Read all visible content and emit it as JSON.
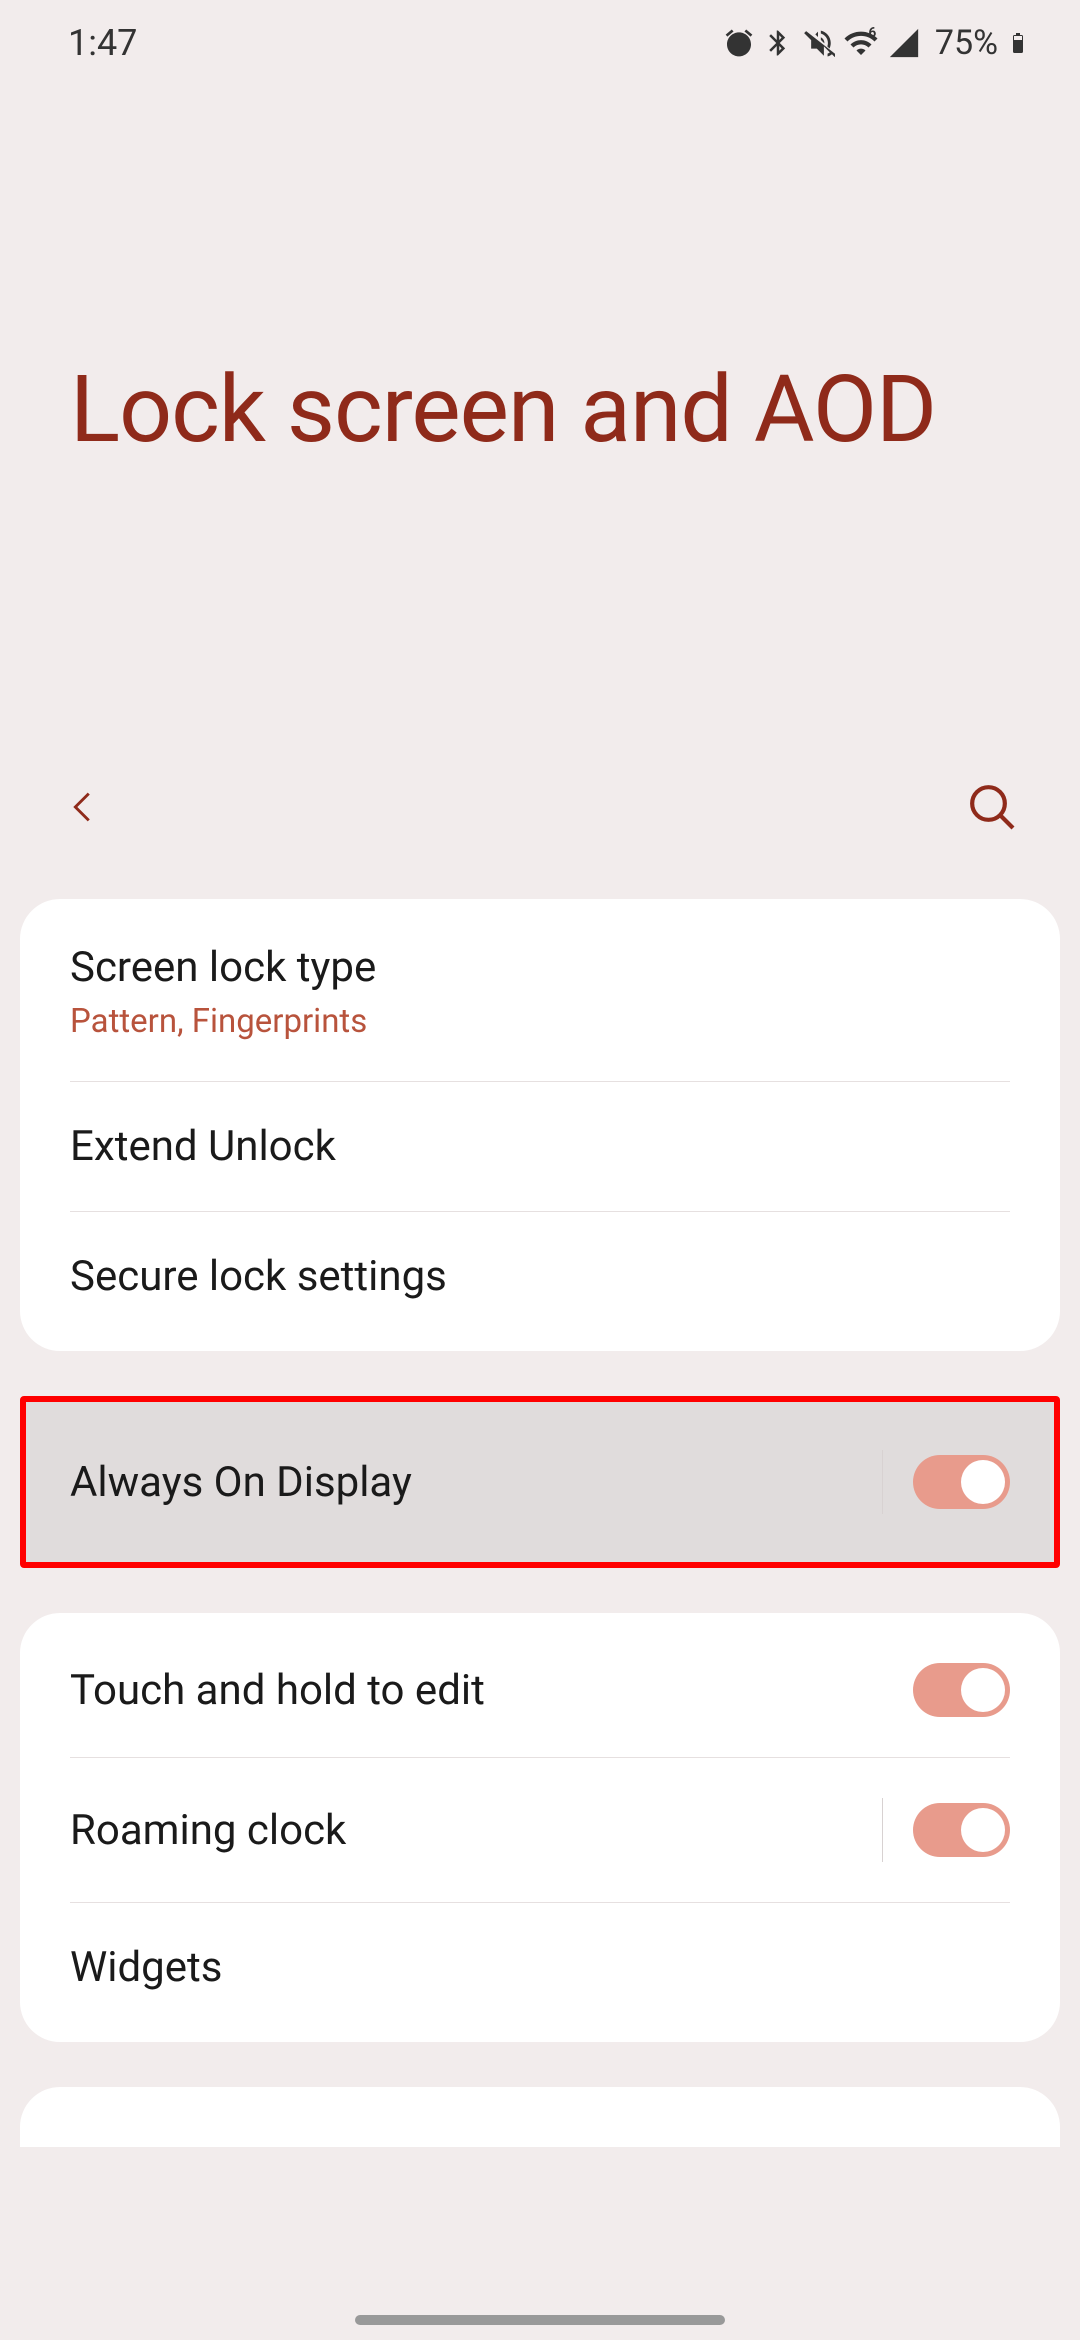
{
  "status": {
    "time": "1:47",
    "battery_pct": "75%"
  },
  "header": {
    "title": "Lock screen and AOD"
  },
  "colors": {
    "accent": "#8f2a1a",
    "toggle_on": "#e89b8c",
    "subtitle": "#b8533c",
    "highlight_border": "#ff0000"
  },
  "group1": {
    "screen_lock_type": {
      "label": "Screen lock type",
      "sub": "Pattern, Fingerprints"
    },
    "extend_unlock": {
      "label": "Extend Unlock"
    },
    "secure_lock": {
      "label": "Secure lock settings"
    }
  },
  "group2": {
    "aod": {
      "label": "Always On Display",
      "on": true
    }
  },
  "group3": {
    "touch_hold": {
      "label": "Touch and hold to edit",
      "on": true
    },
    "roaming_clock": {
      "label": "Roaming clock",
      "on": true
    },
    "widgets": {
      "label": "Widgets"
    }
  }
}
